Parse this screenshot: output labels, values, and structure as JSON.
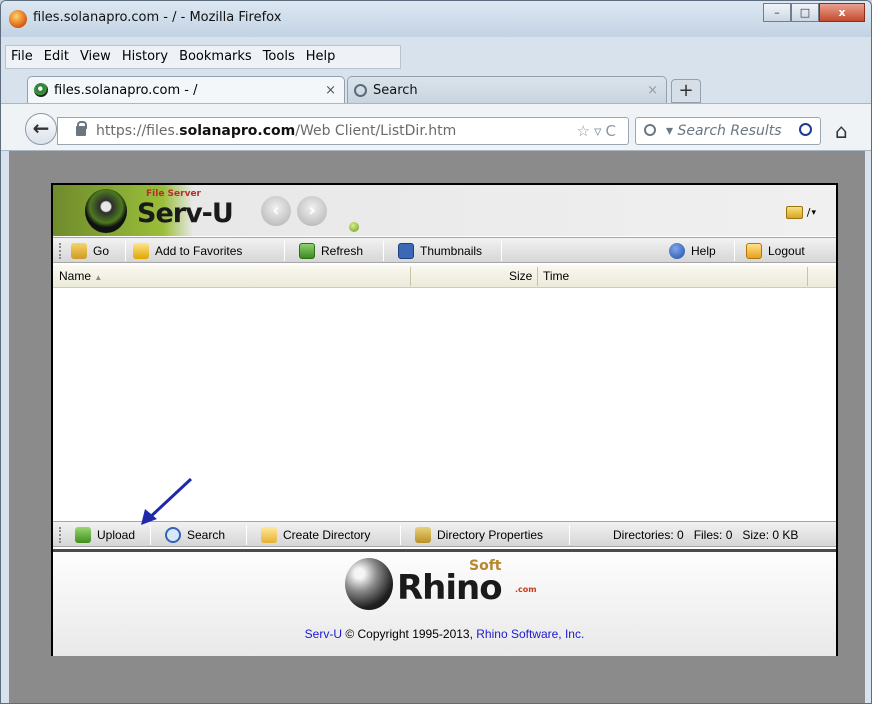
{
  "window": {
    "title": "files.solanapro.com - / - Mozilla Firefox",
    "controls": {
      "minimize": "–",
      "maximize": "□",
      "close": "x"
    }
  },
  "menubar": {
    "items": [
      {
        "label": "File",
        "accel": "F"
      },
      {
        "label": "Edit",
        "accel": "E"
      },
      {
        "label": "View",
        "accel": "V"
      },
      {
        "label": "History",
        "accel": "s"
      },
      {
        "label": "Bookmarks",
        "accel": "B"
      },
      {
        "label": "Tools",
        "accel": "T"
      },
      {
        "label": "Help",
        "accel": "H"
      }
    ]
  },
  "tabs": [
    {
      "label": "files.solanapro.com - /",
      "active": true,
      "close": "×"
    },
    {
      "label": "Search",
      "active": false,
      "close": "×"
    }
  ],
  "new_tab_label": "+",
  "navbar": {
    "back_glyph": "←",
    "url_prefix": "https://files.",
    "url_domain": "solanapro.com",
    "url_path": "/Web Client/ListDir.htm",
    "url_tools": "☆▿C",
    "search_placeholder": "▾ Search Results",
    "home_glyph": "⌂"
  },
  "servu": {
    "file_server_label": "File Server",
    "title": "Serv-U",
    "nav_back": "‹",
    "nav_fwd": "›",
    "current_path": "/",
    "path_menu": "▾",
    "toolbar_top": {
      "go": "Go",
      "add_favorites": "Add to Favorites",
      "refresh": "Refresh",
      "thumbnails": "Thumbnails",
      "help": "Help",
      "logout": "Logout"
    },
    "columns": {
      "name": "Name",
      "name_sort": "▲",
      "size": "Size",
      "time": "Time"
    },
    "toolbar_bottom": {
      "upload": "Upload",
      "search": "Search",
      "create_directory": "Create Directory",
      "directory_properties": "Directory Properties",
      "status": "Directories: 0   Files: 0   Size: 0 KB"
    },
    "footer": {
      "brand": "Rhino",
      "brand_soft": "Soft",
      "brand_com": ".com",
      "copyright_link1": "Serv-U",
      "copyright_text": " © Copyright 1995-2013, ",
      "copyright_link2": "Rhino Software, Inc."
    }
  },
  "colors": {
    "content_gray": "#8b8b8b",
    "link_blue": "#1a1ad0",
    "arrow": "#1f2aa8"
  }
}
